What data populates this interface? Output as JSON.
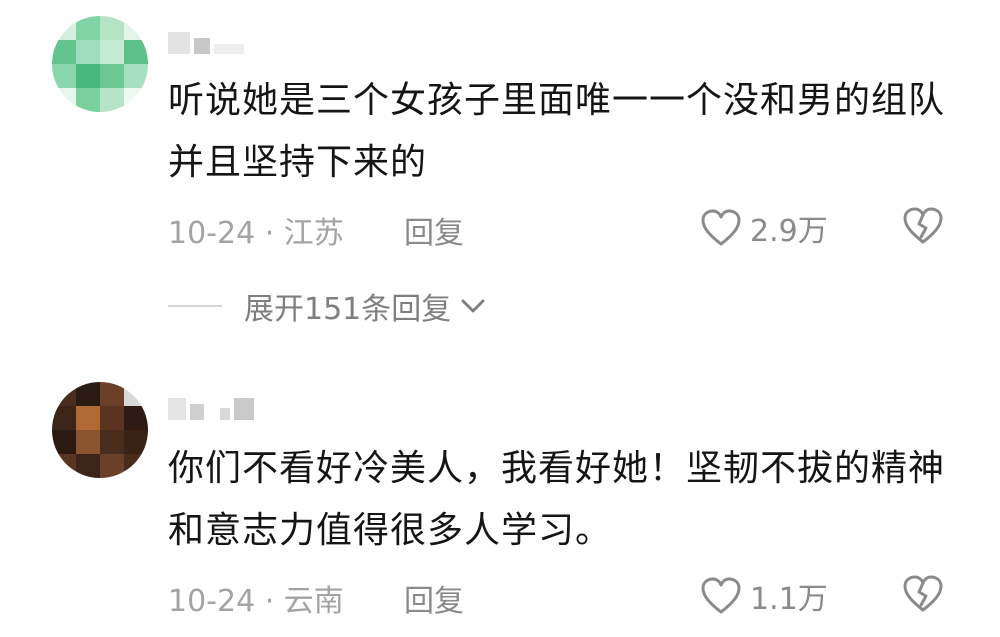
{
  "comments": [
    {
      "text": "听说她是三个女孩子里面唯一一个没和男的组队并且坚持下来的",
      "date_location": "10-24 · 江苏",
      "reply_label": "回复",
      "like_count": "2.9万",
      "avatar_colors": [
        "#c9ecd4",
        "#7fd3a4",
        "#9fdcbb",
        "#6cc895",
        "#48b87c",
        "#b6e4c8"
      ]
    },
    {
      "text": "你们不看好冷美人，我看好她！坚韧不拔的精神和意志力值得很多人学习。",
      "date_location": "10-24 · 云南",
      "reply_label": "回复",
      "like_count": "1.1万",
      "avatar_colors": [
        "#2a1a12",
        "#5a3420",
        "#8a5430",
        "#3c2418",
        "#b06a34",
        "#6a4028"
      ]
    }
  ],
  "expand_replies": {
    "label": "展开151条回复"
  },
  "icons": {
    "like": "heart-outline-icon",
    "dislike": "broken-heart-icon",
    "expand": "chevron-down-icon"
  },
  "colors": {
    "text": "#151515",
    "meta": "#a3a3a3",
    "action": "#8a8a8a"
  }
}
